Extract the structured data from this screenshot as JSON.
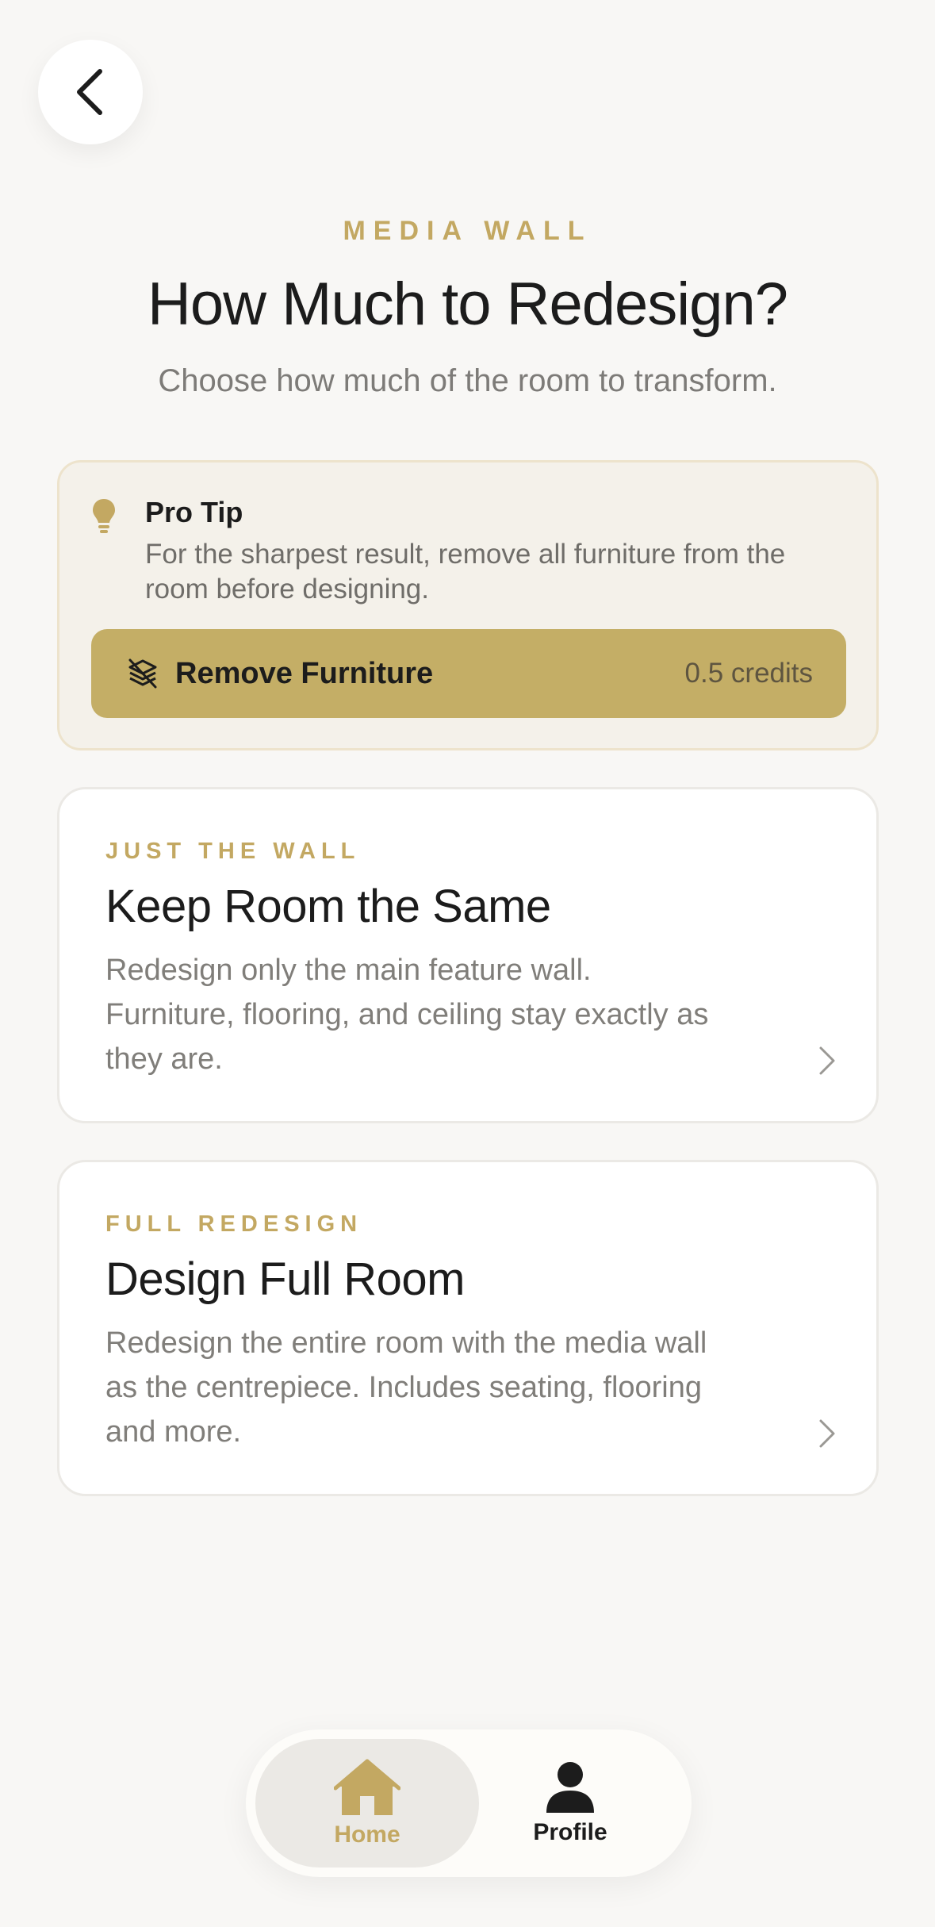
{
  "header": {
    "back_label": "Back",
    "eyebrow": "MEDIA WALL",
    "title": "How Much to Redesign?",
    "subtitle": "Choose how much of the room to transform."
  },
  "tip": {
    "icon": "lightbulb-icon",
    "title": "Pro Tip",
    "text": "For the sharpest result, remove all furniture from the room before designing.",
    "button": {
      "icon": "layers-off-icon",
      "label": "Remove Furniture",
      "credits": "0.5 credits"
    }
  },
  "options": [
    {
      "eyebrow": "JUST THE WALL",
      "title": "Keep Room the Same",
      "description": "Redesign only the main feature wall. Furniture, flooring, and ceiling stay exactly as they are."
    },
    {
      "eyebrow": "FULL REDESIGN",
      "title": "Design Full Room",
      "description": "Redesign the entire room with the media wall as the centrepiece. Includes seating, flooring and more."
    }
  ],
  "tabbar": {
    "items": [
      {
        "label": "Home",
        "icon": "home-icon",
        "active": true
      },
      {
        "label": "Profile",
        "icon": "person-icon",
        "active": false
      }
    ]
  },
  "colors": {
    "accent": "#c3a862",
    "button": "#c4ae66",
    "background": "#f8f7f5"
  }
}
